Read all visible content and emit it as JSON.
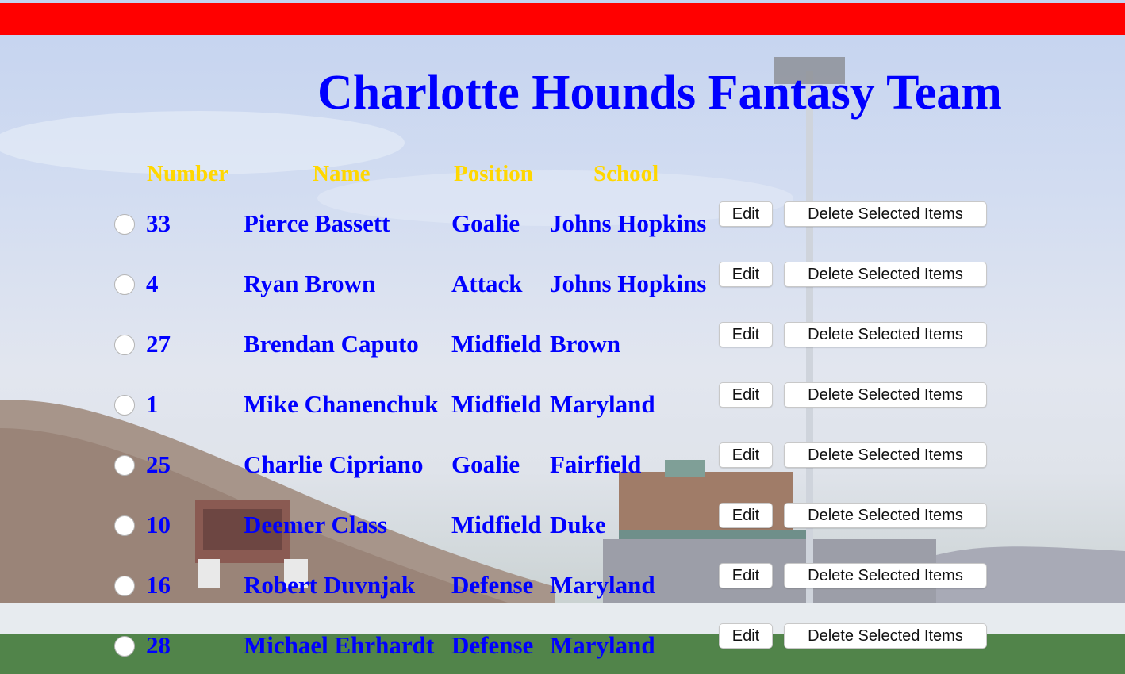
{
  "page": {
    "title": "Charlotte Hounds Fantasy Team",
    "header_bar_color": "#ff0000",
    "title_color": "#0000ff",
    "header_text_color": "#ffd700"
  },
  "table": {
    "columns": [
      "Number",
      "Name",
      "Position",
      "School"
    ],
    "edit_label": "Edit",
    "delete_label": "Delete Selected Items",
    "rows": [
      {
        "number": "33",
        "name": "Pierce Bassett",
        "position": "Goalie",
        "school": "Johns Hopkins",
        "selected": false
      },
      {
        "number": "4",
        "name": "Ryan Brown",
        "position": "Attack",
        "school": "Johns Hopkins",
        "selected": false
      },
      {
        "number": "27",
        "name": "Brendan Caputo",
        "position": "Midfield",
        "school": "Brown",
        "selected": false
      },
      {
        "number": "1",
        "name": "Mike Chanenchuk",
        "position": "Midfield",
        "school": "Maryland",
        "selected": false
      },
      {
        "number": "25",
        "name": "Charlie Cipriano",
        "position": "Goalie",
        "school": "Fairfield",
        "selected": false
      },
      {
        "number": "10",
        "name": "Deemer Class",
        "position": "Midfield",
        "school": "Duke",
        "selected": false
      },
      {
        "number": "16",
        "name": "Robert Duvnjak",
        "position": "Defense",
        "school": "Maryland",
        "selected": false
      },
      {
        "number": "28",
        "name": "Michael Ehrhardt",
        "position": "Defense",
        "school": "Maryland",
        "selected": false
      }
    ]
  }
}
